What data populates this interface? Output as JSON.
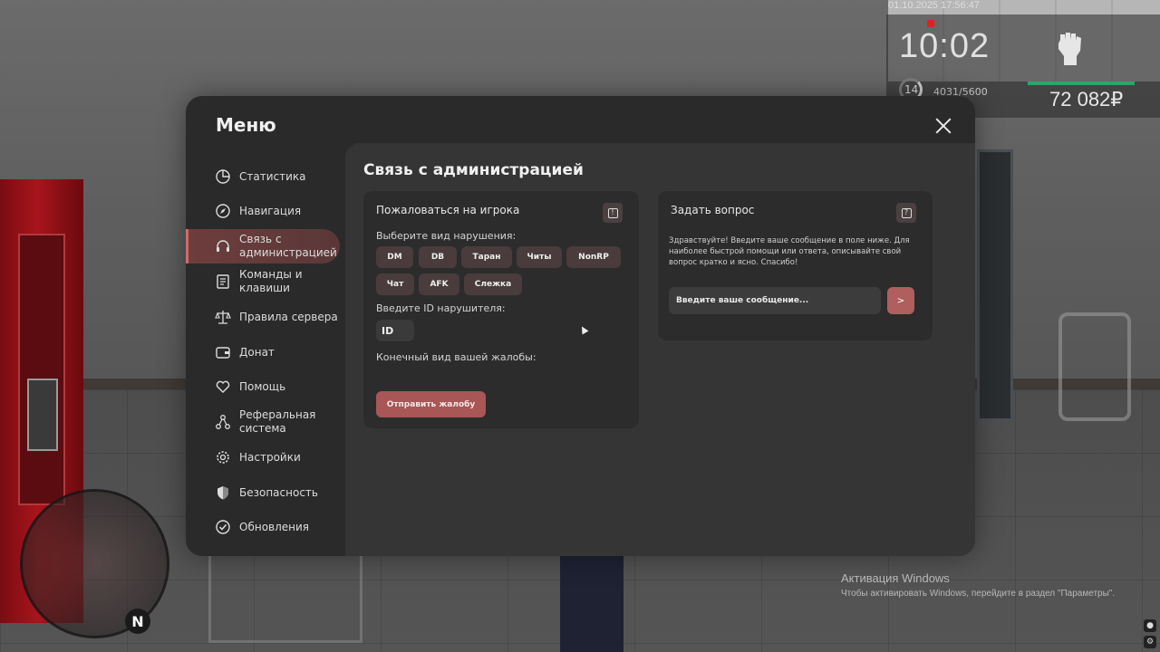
{
  "hud": {
    "datetime": "01.10.2025 17:56:47",
    "time": "10:02",
    "level": "14",
    "xp": "4031/5600",
    "xp_progress": 0.72,
    "money": "72 082₽",
    "icons": {
      "fist": "fist-icon"
    }
  },
  "menu": {
    "title": "Меню",
    "close_icon": "close-icon"
  },
  "sidebar": {
    "items": [
      {
        "label": "Статистика",
        "icon": "pie-chart-icon",
        "active": false
      },
      {
        "label": "Навигация",
        "icon": "compass-icon",
        "active": false
      },
      {
        "label": "Связь с администрацией",
        "icon": "headset-icon",
        "active": true
      },
      {
        "label": "Команды и клавиши",
        "icon": "document-icon",
        "active": false
      },
      {
        "label": "Правила сервера",
        "icon": "scales-icon",
        "active": false
      },
      {
        "label": "Донат",
        "icon": "wallet-icon",
        "active": false
      },
      {
        "label": "Помощь",
        "icon": "heart-hand-icon",
        "active": false
      },
      {
        "label": "Реферальная система",
        "icon": "network-icon",
        "active": false
      },
      {
        "label": "Настройки",
        "icon": "gear-icon",
        "active": false
      },
      {
        "label": "Безопасность",
        "icon": "shield-icon",
        "active": false
      },
      {
        "label": "Обновления",
        "icon": "check-circle-icon",
        "active": false
      }
    ]
  },
  "content": {
    "title": "Связь с администрацией",
    "report": {
      "title": "Пожаловаться на игрока",
      "icon": "alert-icon",
      "violation_label": "Выберите вид нарушения:",
      "violations": [
        "DM",
        "DB",
        "Таран",
        "Читы",
        "NonRP",
        "Чат",
        "AFK",
        "Слежка"
      ],
      "id_label": "Введите ID нарушителя:",
      "id_placeholder": "ID",
      "final_label": "Конечный вид вашей жалобы:",
      "submit_label": "Отправить жалобу"
    },
    "question": {
      "title": "Задать вопрос",
      "icon": "question-icon",
      "text": "Здравствуйте! Введите ваше сообщение в поле ниже. Для наиболее быстрой помощи или ответа, описывайте свой вопрос кратко и ясно. Спасибо!",
      "input_placeholder": "Введите ваше сообщение...",
      "send_label": ">"
    }
  },
  "minimap": {
    "compass": "N"
  },
  "windows": {
    "activation_title": "Активация Windows",
    "activation_text": "Чтобы активировать Windows, перейдите в раздел \"Параметры\"."
  },
  "colors": {
    "accent": "#a85656",
    "panel": "#2a2a2a",
    "content": "#353535",
    "card": "#2c2c2c"
  }
}
